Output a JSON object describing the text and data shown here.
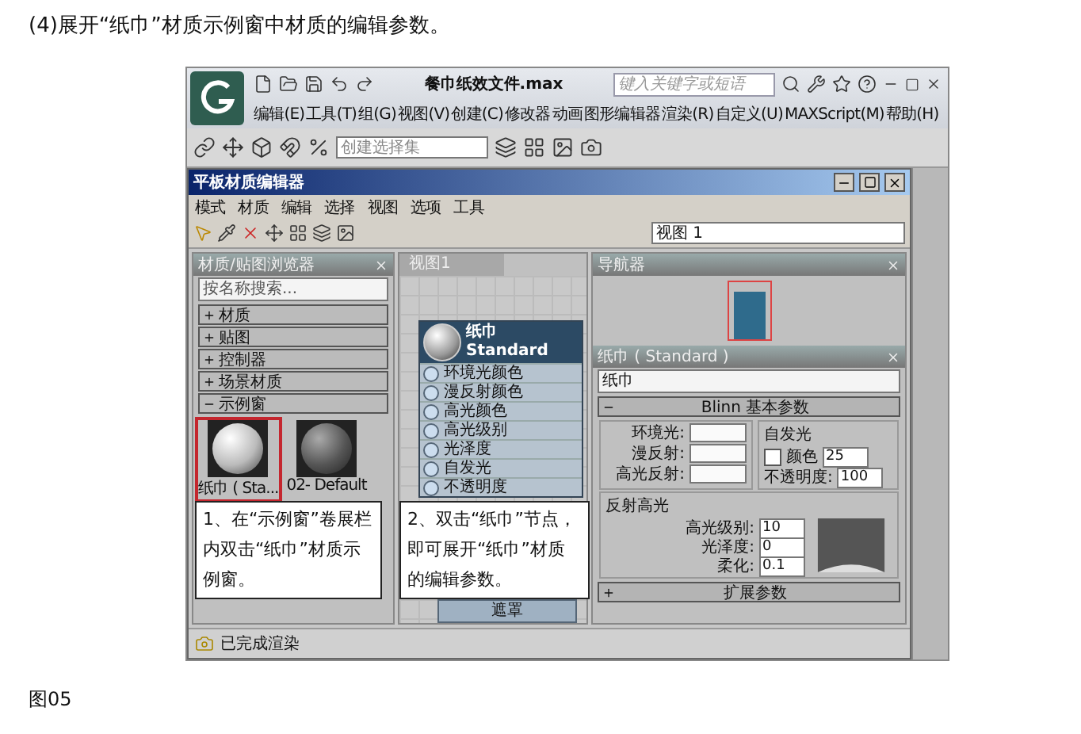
{
  "heading": "(4)展开“纸巾”材质示例窗中材质的编辑参数。",
  "app": {
    "title": "餐巾纸效文件.max",
    "search": {
      "placeholder": "键入关键字或短语"
    },
    "menu": [
      "编辑(E)",
      "工具(T)",
      "组(G)",
      "视图(V)",
      "创建(C)",
      "修改器",
      "动画",
      "图形编辑器",
      "渲染(R)",
      "自定义(U)",
      "MAXScript(M)",
      "帮助(H)"
    ],
    "selection_set": {
      "placeholder": "创建选择集"
    }
  },
  "editor": {
    "title": "平板材质编辑器",
    "menu": [
      "模式",
      "材质",
      "编辑",
      "选择",
      "视图",
      "选项",
      "工具"
    ],
    "view_select": "视图 1",
    "browser": {
      "title": "材质/贴图浏览器",
      "search": {
        "placeholder": "按名称搜索..."
      },
      "groups": [
        {
          "label": "材质",
          "expanded": false
        },
        {
          "label": "贴图",
          "expanded": false
        },
        {
          "label": "控制器",
          "expanded": false
        },
        {
          "label": "场景材质",
          "expanded": false
        },
        {
          "label": "示例窗",
          "expanded": true
        }
      ],
      "samples": [
        {
          "label": "纸巾 ( Sta...",
          "selected": true
        },
        {
          "label": "02- Default",
          "selected": false
        }
      ]
    },
    "view_tab": "视图1",
    "node": {
      "name": "纸巾",
      "type": "Standard",
      "slots": [
        "环境光颜色",
        "漫反射颜色",
        "高光颜色",
        "高光级别",
        "光泽度",
        "自发光",
        "不透明度"
      ],
      "footer": "遮罩"
    },
    "navigator": {
      "title": "导航器"
    },
    "params": {
      "title": "纸巾 ( Standard )",
      "name": "纸巾",
      "rollouts": [
        {
          "label": "Blinn 基本参数",
          "expanded": true
        },
        {
          "label": "扩展参数",
          "expanded": false
        }
      ],
      "color_labels": [
        "环境光:",
        "漫反射:",
        "高光反射:"
      ],
      "self_illum": {
        "title": "自发光",
        "label": "颜色",
        "checked": false,
        "value": "25"
      },
      "opacity": {
        "label": "不透明度:",
        "value": "100"
      },
      "highlights": {
        "title": "反射高光",
        "fields": [
          {
            "label": "高光级别:",
            "value": "10"
          },
          {
            "label": "光泽度:",
            "value": "0"
          },
          {
            "label": "柔化:",
            "value": "0.1"
          }
        ]
      }
    }
  },
  "status": "已完成渲染",
  "callouts": [
    "1、在“示例窗”卷展栏内双击“纸巾”材质示例窗。",
    "2、双击“纸巾”节点，即可展开“纸巾”材质的编辑参数。"
  ],
  "figure_label": "图05"
}
